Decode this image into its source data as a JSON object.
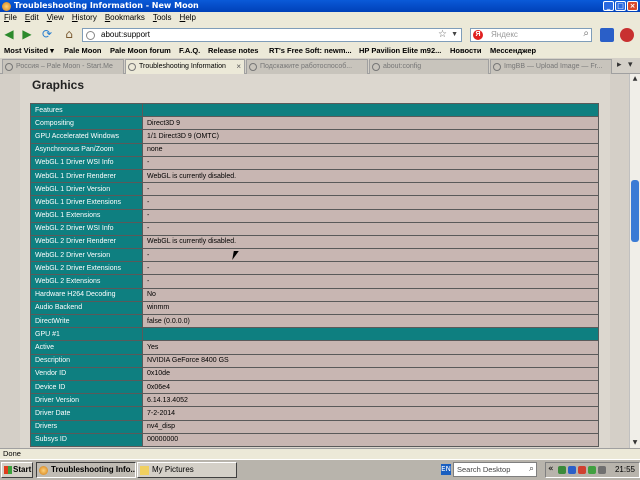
{
  "window": {
    "title": "Troubleshooting Information - New Moon"
  },
  "menu": [
    "File",
    "Edit",
    "View",
    "History",
    "Bookmarks",
    "Tools",
    "Help"
  ],
  "navbar": {
    "url": "about:support",
    "search_placeholder": "Яндекс"
  },
  "bookmarks": [
    "Most Visited ▾",
    "Pale Moon",
    "Pale Moon forum",
    "F.A.Q.",
    "Release notes",
    "RT's Free Soft: newm...",
    "HP Pavilion Elite m92...",
    "Новости",
    "Мессенджер"
  ],
  "tabs": [
    {
      "label": "Россия – Pale Moon - Start.Me"
    },
    {
      "label": "Troubleshooting Information"
    },
    {
      "label": "Подскажите работоспособ..."
    },
    {
      "label": "about:config"
    },
    {
      "label": "ImgBB — Upload Image — Fr..."
    }
  ],
  "page": {
    "heading": "Graphics",
    "rows": [
      {
        "key": "Features",
        "value": "",
        "header": true
      },
      {
        "key": "Compositing",
        "value": "Direct3D 9"
      },
      {
        "key": "GPU Accelerated Windows",
        "value": "1/1 Direct3D 9 (OMTC)"
      },
      {
        "key": "Asynchronous Pan/Zoom",
        "value": "none"
      },
      {
        "key": "WebGL 1 Driver WSI Info",
        "value": "-"
      },
      {
        "key": "WebGL 1 Driver Renderer",
        "value": "WebGL is currently disabled."
      },
      {
        "key": "WebGL 1 Driver Version",
        "value": "-"
      },
      {
        "key": "WebGL 1 Driver Extensions",
        "value": "-"
      },
      {
        "key": "WebGL 1 Extensions",
        "value": "-"
      },
      {
        "key": "WebGL 2 Driver WSI Info",
        "value": "-"
      },
      {
        "key": "WebGL 2 Driver Renderer",
        "value": "WebGL is currently disabled."
      },
      {
        "key": "WebGL 2 Driver Version",
        "value": "-"
      },
      {
        "key": "WebGL 2 Driver Extensions",
        "value": "-"
      },
      {
        "key": "WebGL 2 Extensions",
        "value": "-"
      },
      {
        "key": "Hardware H264 Decoding",
        "value": "No"
      },
      {
        "key": "Audio Backend",
        "value": "winmm"
      },
      {
        "key": "DirectWrite",
        "value": "false (0.0.0.0)"
      },
      {
        "key": "GPU #1",
        "value": "",
        "header": true
      },
      {
        "key": "Active",
        "value": "Yes"
      },
      {
        "key": "Description",
        "value": "NVIDIA GeForce 8400 GS"
      },
      {
        "key": "Vendor ID",
        "value": "0x10de"
      },
      {
        "key": "Device ID",
        "value": "0x06e4"
      },
      {
        "key": "Driver Version",
        "value": "6.14.13.4052"
      },
      {
        "key": "Driver Date",
        "value": "7-2-2014"
      },
      {
        "key": "Drivers",
        "value": "nv4_disp"
      },
      {
        "key": "Subsys ID",
        "value": "00000000"
      }
    ]
  },
  "status": {
    "text": "Done"
  },
  "taskbar": {
    "start_label": "Start",
    "buttons": [
      "Troubleshooting Info...",
      "My Pictures"
    ],
    "lang": "EN",
    "search_placeholder": "Search Desktop",
    "clock": "21:55"
  }
}
